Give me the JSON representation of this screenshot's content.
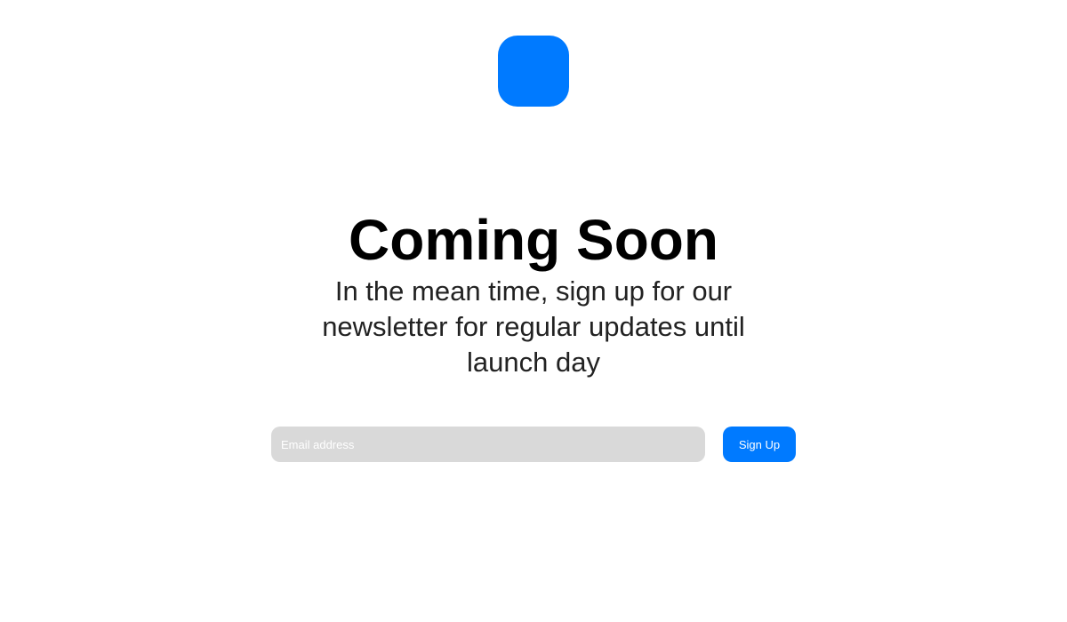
{
  "colors": {
    "accent": "#007AFF",
    "input_background": "#D9D9D9",
    "background": "#FFFFFF"
  },
  "logo": {
    "icon": "app-logo-icon"
  },
  "hero": {
    "title": "Coming Soon",
    "subtitle": "In the mean time, sign up for our newsletter for regular updates until launch day"
  },
  "signup": {
    "email_placeholder": "Email address",
    "email_value": "",
    "button_label": "Sign Up"
  }
}
